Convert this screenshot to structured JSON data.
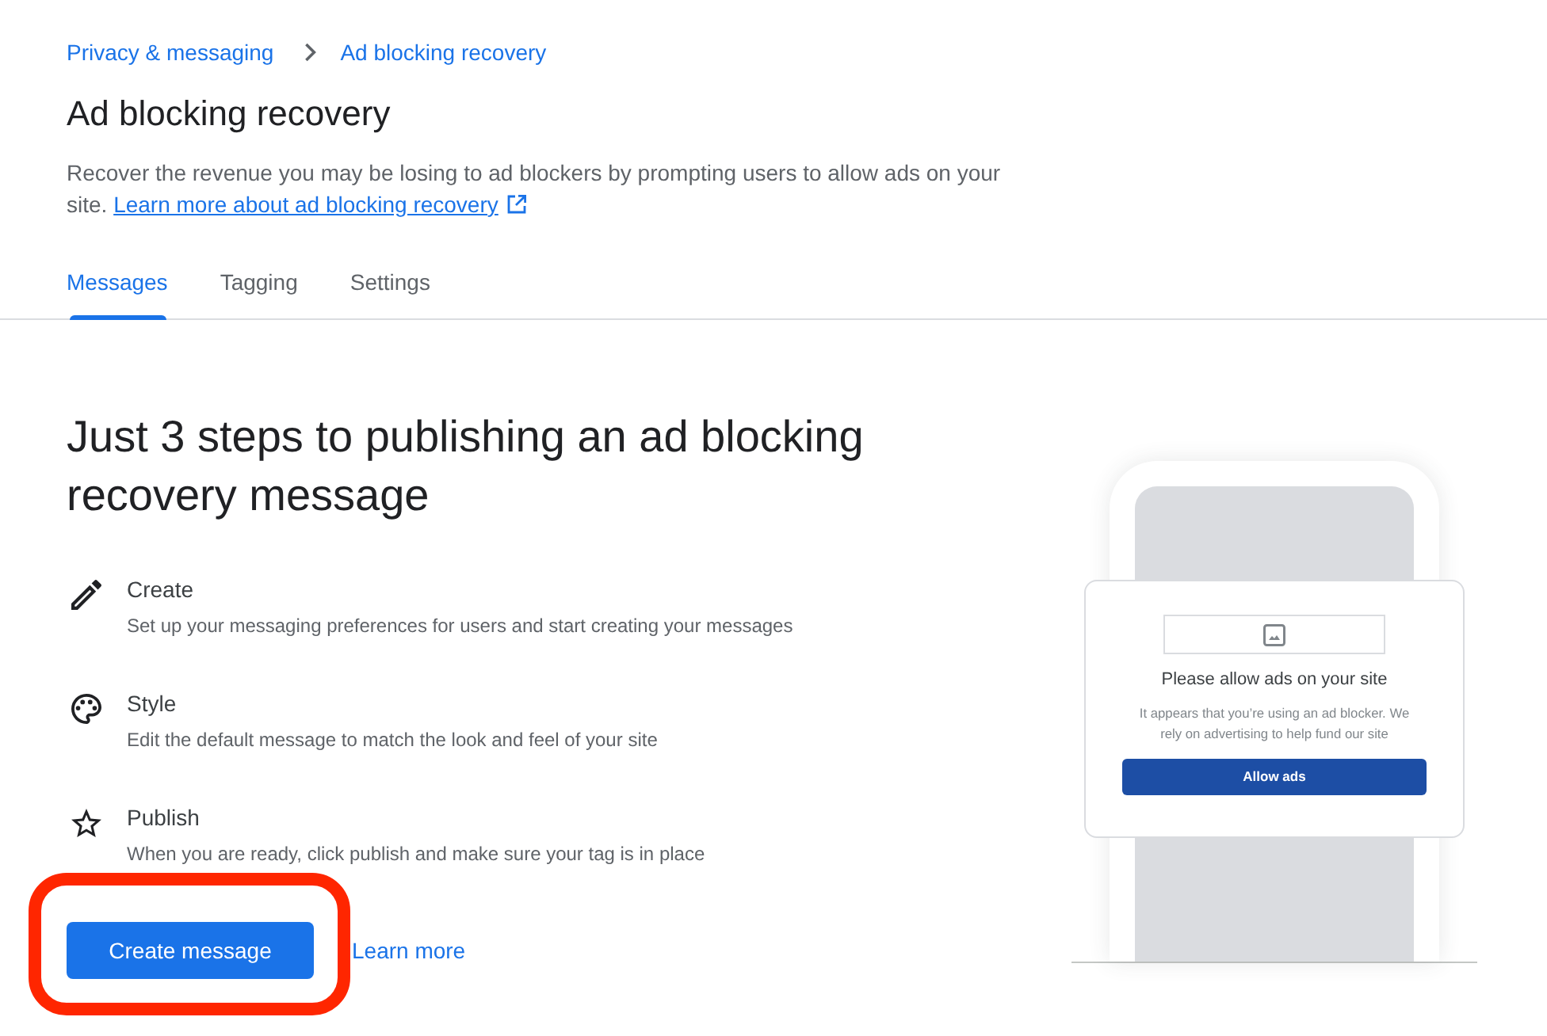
{
  "breadcrumb": [
    {
      "label": "Privacy & messaging"
    },
    {
      "label": "Ad blocking recovery"
    }
  ],
  "header": {
    "title": "Ad blocking recovery",
    "description": "Recover the revenue you may be losing to ad blockers by prompting users to allow ads on your site.",
    "link": "Learn more about ad blocking recovery"
  },
  "tabs": [
    {
      "label": "Messages",
      "selected": true
    },
    {
      "label": "Tagging",
      "selected": false
    },
    {
      "label": "Settings",
      "selected": false
    }
  ],
  "intro": {
    "heading": "Just 3 steps to publishing an ad blocking recovery message",
    "steps": [
      {
        "kind": "edit",
        "title": "Create",
        "description": "Set up your messaging preferences for users and start creating your messages"
      },
      {
        "kind": "palette",
        "title": "Style",
        "description": "Edit the default message to match the look and feel of your site"
      },
      {
        "kind": "star",
        "title": "Publish",
        "description": "When you are ready, click publish and make sure your tag is in place"
      }
    ]
  },
  "actions": {
    "primary": {
      "label": "Create message",
      "highlighted": true
    },
    "secondary": {
      "label": "Learn more"
    }
  },
  "preview": {
    "title": "Please allow ads on your site",
    "body": "It appears that you’re using an ad blocker. We rely on advertising to help fund our site",
    "button": "Allow ads"
  }
}
